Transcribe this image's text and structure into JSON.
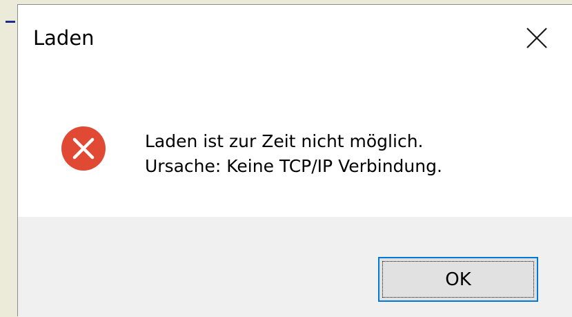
{
  "dialog": {
    "title": "Laden",
    "close_icon": "close-icon",
    "message_line1": "Laden ist zur Zeit nicht möglich.",
    "message_line2": "Ursache: Keine TCP/IP Verbindung.",
    "status_icon": "error-icon",
    "ok_label": "OK"
  },
  "colors": {
    "error_red": "#e04a35",
    "button_border": "#0078d7",
    "footer_bg": "#f0f0f0"
  }
}
